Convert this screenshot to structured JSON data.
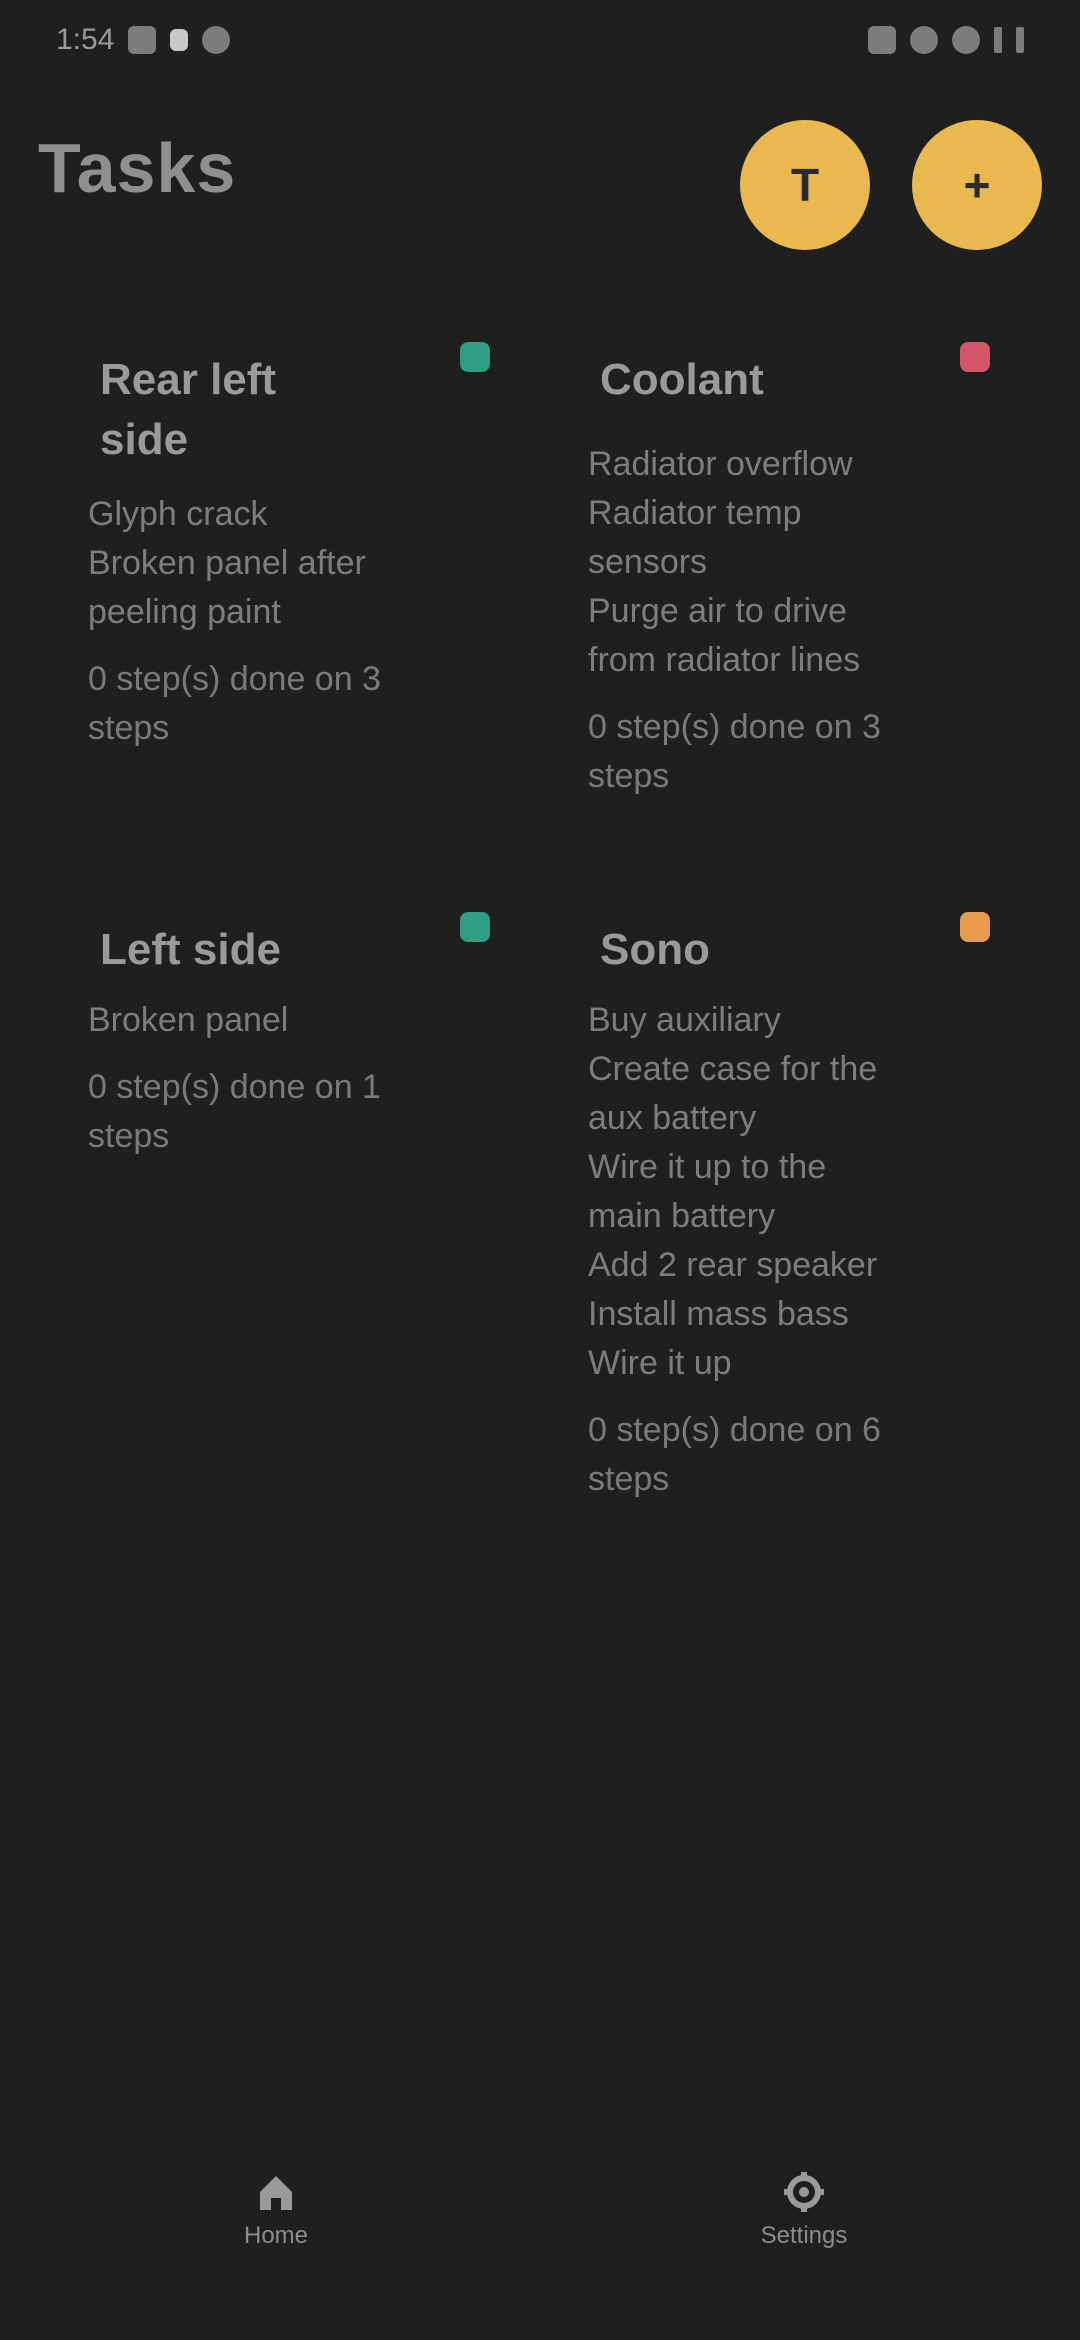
{
  "status_bar": {
    "time": "1:54"
  },
  "header": {
    "title": "Tasks",
    "filter_icon": "filter-icon",
    "add_icon": "plus-icon",
    "filter_glyph": "T",
    "add_glyph": "+"
  },
  "tasks": [
    {
      "title": "Rear left side",
      "items": [
        "Glyph crack",
        "Broken panel after",
        "peeling paint"
      ],
      "progress": "0 step(s) done on 3 steps",
      "color": "#2f9e83"
    },
    {
      "title": "Coolant",
      "items": [
        "Radiator overflow",
        "Radiator temp",
        "sensors",
        "Purge air to drive",
        "from radiator lines"
      ],
      "progress": "0 step(s) done on 3 steps",
      "color": "#d4566a"
    },
    {
      "title": "Left side",
      "items": [
        "Broken panel"
      ],
      "progress": "0 step(s) done on 1 steps",
      "color": "#2f9e83"
    },
    {
      "title": "Sono",
      "items": [
        "Buy auxiliary",
        "Create case for the",
        "aux battery",
        "Wire it up to the",
        "main battery",
        "Add 2 rear speaker",
        "Install mass bass",
        "Wire it up"
      ],
      "progress": "0 step(s) done on 6 steps",
      "color": "#e89c4e"
    }
  ],
  "bottom_nav": {
    "home_label": "Home",
    "settings_label": "Settings",
    "home_icon": "home-icon",
    "settings_icon": "gear-icon"
  }
}
